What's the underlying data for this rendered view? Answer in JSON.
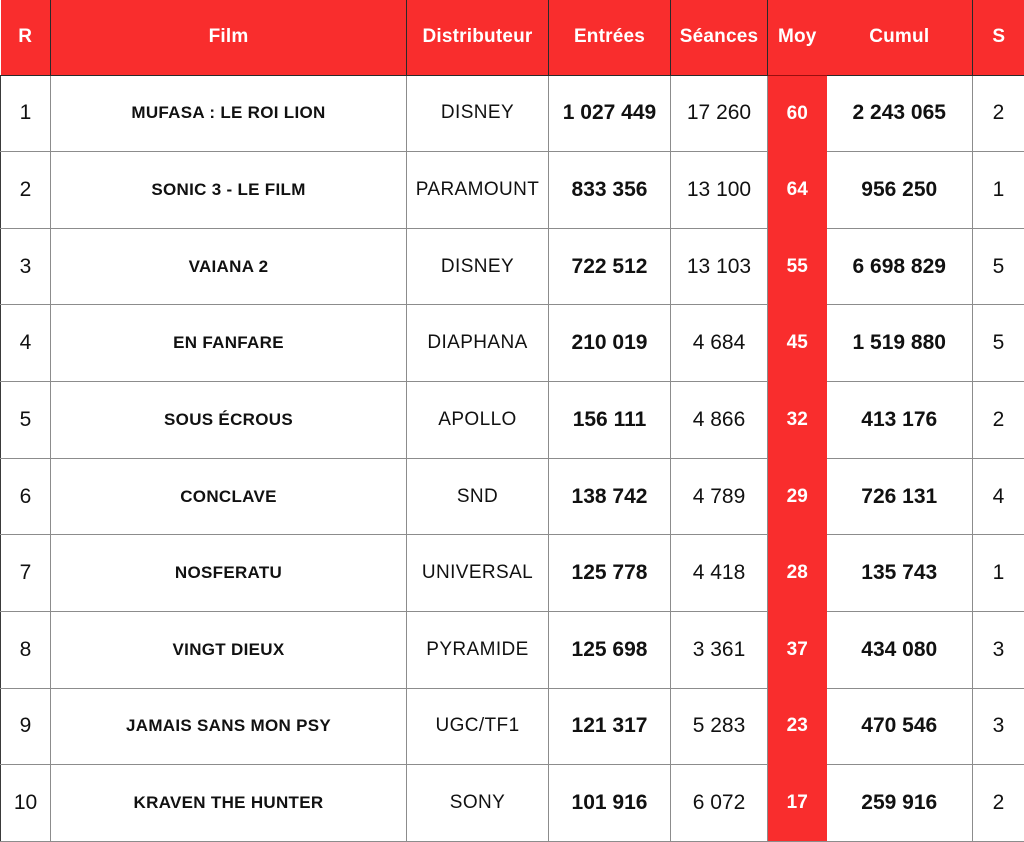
{
  "table": {
    "accent_color": "#f92d2d",
    "header_text_color": "#ffffff",
    "grid_color": "#8c8c8c",
    "columns": [
      {
        "key": "rank",
        "label": "R"
      },
      {
        "key": "film",
        "label": "Film"
      },
      {
        "key": "distributor",
        "label": "Distributeur"
      },
      {
        "key": "entries",
        "label": "Entrées"
      },
      {
        "key": "sessions",
        "label": "Séances"
      },
      {
        "key": "avg",
        "label": "Moy"
      },
      {
        "key": "cumul",
        "label": "Cumul"
      },
      {
        "key": "weeks",
        "label": "S"
      }
    ],
    "rows": [
      {
        "rank": "1",
        "film": "MUFASA : LE ROI LION",
        "distributor": "DISNEY",
        "entries": "1 027 449",
        "sessions": "17 260",
        "avg": "60",
        "cumul": "2 243 065",
        "weeks": "2"
      },
      {
        "rank": "2",
        "film": "SONIC 3 - LE FILM",
        "distributor": "PARAMOUNT",
        "entries": "833 356",
        "sessions": "13 100",
        "avg": "64",
        "cumul": "956 250",
        "weeks": "1"
      },
      {
        "rank": "3",
        "film": "VAIANA 2",
        "distributor": "DISNEY",
        "entries": "722 512",
        "sessions": "13 103",
        "avg": "55",
        "cumul": "6 698 829",
        "weeks": "5"
      },
      {
        "rank": "4",
        "film": "EN FANFARE",
        "distributor": "DIAPHANA",
        "entries": "210 019",
        "sessions": "4 684",
        "avg": "45",
        "cumul": "1 519 880",
        "weeks": "5"
      },
      {
        "rank": "5",
        "film": "SOUS ÉCROUS",
        "distributor": "APOLLO",
        "entries": "156 111",
        "sessions": "4 866",
        "avg": "32",
        "cumul": "413 176",
        "weeks": "2"
      },
      {
        "rank": "6",
        "film": "CONCLAVE",
        "distributor": "SND",
        "entries": "138 742",
        "sessions": "4 789",
        "avg": "29",
        "cumul": "726 131",
        "weeks": "4"
      },
      {
        "rank": "7",
        "film": "NOSFERATU",
        "distributor": "UNIVERSAL",
        "entries": "125 778",
        "sessions": "4 418",
        "avg": "28",
        "cumul": "135 743",
        "weeks": "1"
      },
      {
        "rank": "8",
        "film": "VINGT DIEUX",
        "distributor": "PYRAMIDE",
        "entries": "125 698",
        "sessions": "3 361",
        "avg": "37",
        "cumul": "434 080",
        "weeks": "3"
      },
      {
        "rank": "9",
        "film": "JAMAIS SANS MON PSY",
        "distributor": "UGC/TF1",
        "entries": "121 317",
        "sessions": "5 283",
        "avg": "23",
        "cumul": "470 546",
        "weeks": "3"
      },
      {
        "rank": "10",
        "film": "KRAVEN THE HUNTER",
        "distributor": "SONY",
        "entries": "101 916",
        "sessions": "6 072",
        "avg": "17",
        "cumul": "259 916",
        "weeks": "2"
      }
    ]
  }
}
